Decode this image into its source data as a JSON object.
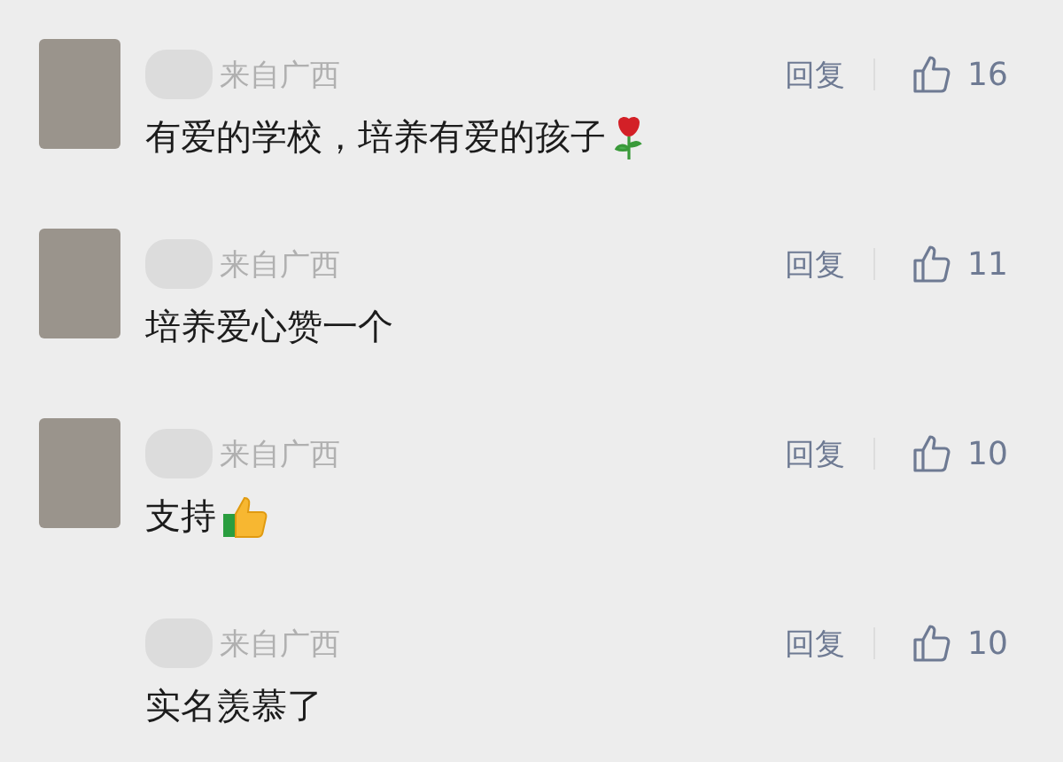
{
  "comments": [
    {
      "avatar": true,
      "location": "来自广西",
      "reply": "回复",
      "likes": "16",
      "text": "有爱的学校，培养有爱的孩子",
      "kind": "rose"
    },
    {
      "avatar": true,
      "location": "来自广西",
      "reply": "回复",
      "likes": "11",
      "text": "培养爱心赞一个",
      "kind": "plain"
    },
    {
      "avatar": true,
      "location": "来自广西",
      "reply": "回复",
      "likes": "10",
      "text": "支持",
      "kind": "thumbs_up"
    },
    {
      "avatar": false,
      "location": "来自广西",
      "reply": "回复",
      "likes": "10",
      "text": "实名羡慕了",
      "kind": "plain"
    }
  ]
}
